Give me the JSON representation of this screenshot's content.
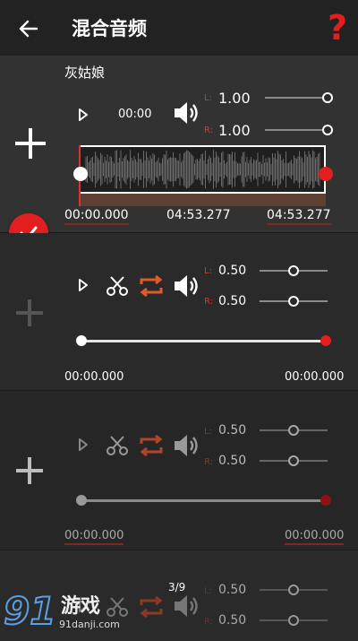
{
  "header": {
    "title": "混合音频",
    "back_icon": "arrow-left-icon",
    "help_icon": "question-mark-icon",
    "help_color": "#e21e1e"
  },
  "tracks": [
    {
      "name": "灰姑娘",
      "play_time": "00:00",
      "left_label": "L:",
      "left_value": "1.00",
      "right_label": "R:",
      "right_value": "1.00",
      "left_level": 1.0,
      "right_level": 1.0,
      "start_time": "00:00.000",
      "end_time": "04:53.277",
      "total_time": "04:53.277",
      "selected": true
    },
    {
      "left_label": "L:",
      "left_value": "0.50",
      "right_label": "R:",
      "right_value": "0.50",
      "left_level": 0.5,
      "right_level": 0.5,
      "start_time": "00:00.000",
      "end_time": "00:00.000"
    },
    {
      "left_label": "L:",
      "left_value": "0.50",
      "right_label": "R:",
      "right_value": "0.50",
      "left_level": 0.5,
      "right_level": 0.5,
      "start_time": "00:00.000",
      "end_time": "00:00.000"
    },
    {
      "left_label": "L:",
      "left_value": "0.50",
      "right_label": "R:",
      "right_value": "0.50",
      "left_level": 0.5,
      "right_level": 0.5
    }
  ],
  "page_indicator": "3/9",
  "watermark": {
    "brand": "游戏",
    "logo_number": "91",
    "url": "91danji.com"
  },
  "colors": {
    "accent": "#e21e1e",
    "loop": "#e05a2a"
  }
}
